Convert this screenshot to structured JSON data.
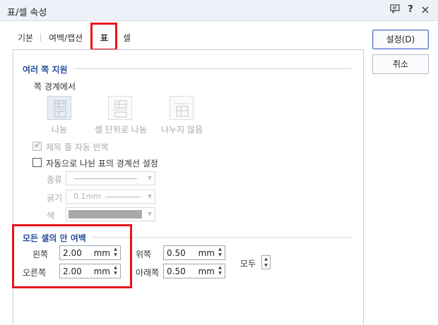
{
  "window": {
    "title": "표/셀 속성"
  },
  "titlebar": {
    "help_icon": "?",
    "close_icon": "×"
  },
  "tabs": [
    {
      "label": "기본"
    },
    {
      "label": "여백/캡션"
    },
    {
      "label": "표"
    },
    {
      "label": "셀"
    }
  ],
  "buttons": {
    "ok": "설정(D)",
    "cancel": "취소"
  },
  "multi_page": {
    "title": "여러 쪽 지원",
    "boundary_label": "쪽 경계에서",
    "options": [
      {
        "label": "나눔",
        "icon": "split-icon",
        "selected": true
      },
      {
        "label": "셀 단위로 나눔",
        "icon": "split-by-cell-icon",
        "selected": false
      },
      {
        "label": "나누지 않음",
        "icon": "no-split-icon",
        "selected": false
      }
    ],
    "repeat_title_label": "제목 줄 자동 반복",
    "repeat_title_checked": true,
    "auto_border_label": "자동으로 나뉜 표의 경계선 설정",
    "auto_border_checked": false,
    "line_type_label": "종류",
    "thickness_label": "굵기",
    "thickness_value": "0.1mm",
    "color_label": "색"
  },
  "cell_margin": {
    "title": "모든 셀의 안 여백",
    "left_label": "왼쪽",
    "left_value": "2.00",
    "right_label": "오른쪽",
    "right_value": "2.00",
    "top_label": "위쪽",
    "top_value": "0.50",
    "bottom_label": "아래쪽",
    "bottom_value": "0.50",
    "unit": "mm",
    "all_label": "모두"
  },
  "colors": {
    "highlight": "#e8141b",
    "section_title": "#2a4f9e"
  }
}
